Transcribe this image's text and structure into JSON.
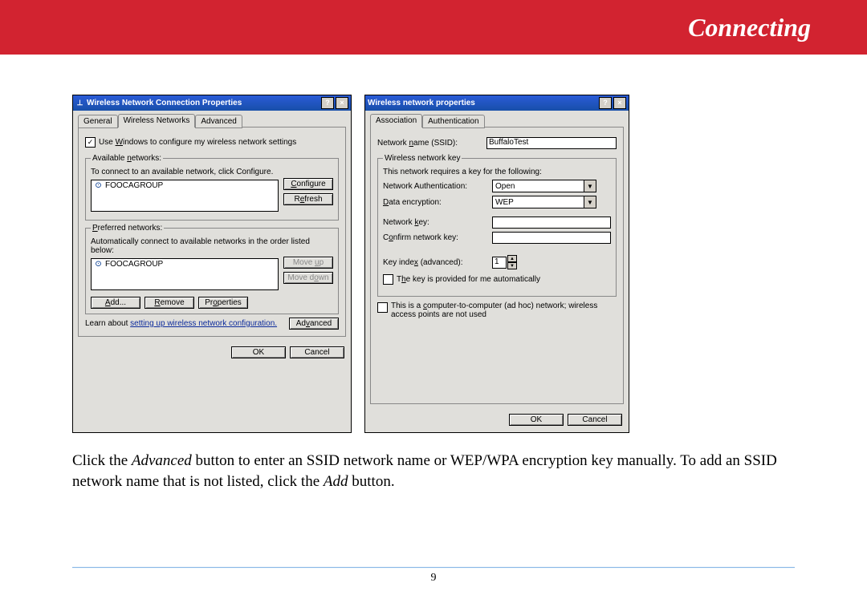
{
  "header": {
    "title": "Connecting"
  },
  "page_number": "9",
  "instruction": {
    "part1": "Click the ",
    "em1": "Advanced",
    "part2": " button to enter an SSID network name or WEP/WPA encryption key manually.  To add an SSID network name that is not listed, click the ",
    "em2": "Add",
    "part3": " button."
  },
  "dialog1": {
    "title": "Wireless Network Connection Properties",
    "help_icon": "?",
    "close_icon": "×",
    "tabs": {
      "general": "General",
      "wireless": "Wireless Networks",
      "advanced": "Advanced"
    },
    "use_windows": "Use Windows to configure my wireless network settings",
    "use_windows_checked": "✓",
    "available_legend": "Available networks:",
    "available_hint": "To connect to an available network, click Configure.",
    "network_item": "FOOCAGROUP",
    "btn_configure": "Configure",
    "btn_refresh": "Refresh",
    "preferred_legend": "Preferred networks:",
    "preferred_hint": "Automatically connect to available networks in the order listed below:",
    "btn_moveup": "Move up",
    "btn_movedown": "Move down",
    "btn_add": "Add...",
    "btn_remove": "Remove",
    "btn_properties": "Properties",
    "learn1": "Learn about ",
    "learn_link": "setting up wireless network configuration.",
    "btn_advanced": "Advanced",
    "btn_ok": "OK",
    "btn_cancel": "Cancel"
  },
  "dialog2": {
    "title": "Wireless network properties",
    "help_icon": "?",
    "close_icon": "×",
    "tabs": {
      "assoc": "Association",
      "auth": "Authentication"
    },
    "ssid_label": "Network name (SSID):",
    "ssid_value": "BuffaloTest",
    "key_legend": "Wireless network key",
    "key_hint": "This network requires a key for the following:",
    "netauth_label": "Network Authentication:",
    "netauth_value": "Open",
    "dataenc_label": "Data encryption:",
    "dataenc_value": "WEP",
    "netkey_label": "Network key:",
    "confirm_label": "Confirm network key:",
    "keyidx_label": "Key index (advanced):",
    "keyidx_value": "1",
    "provided_label": "The key is provided for me automatically",
    "adhoc_label": "This is a computer-to-computer (ad hoc) network; wireless access points are not used",
    "btn_ok": "OK",
    "btn_cancel": "Cancel"
  }
}
